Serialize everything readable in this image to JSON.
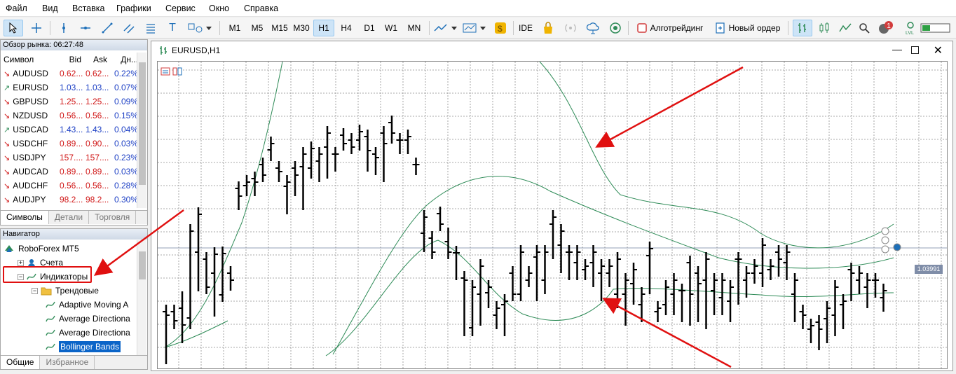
{
  "menu": [
    "Файл",
    "Вид",
    "Вставка",
    "Графики",
    "Сервис",
    "Окно",
    "Справка"
  ],
  "toolbar": {
    "timeframes": [
      "M1",
      "M5",
      "M15",
      "M30",
      "H1",
      "H4",
      "D1",
      "W1",
      "MN"
    ],
    "active_timeframe": "H1",
    "ide_label": "IDE",
    "algo_label": "Алготрейдинг",
    "new_order_label": "Новый ордер",
    "notification_count": "1",
    "icons": [
      "cursor-icon",
      "crosshair-icon",
      "vertical-line-icon",
      "horizontal-line-icon",
      "trendline-icon",
      "channel-icon",
      "fibonacci-icon",
      "text-icon",
      "shapes-icon",
      "chart-type-icon",
      "template-icon",
      "market-icon",
      "signals-icon",
      "vps-icon",
      "hosting-icon",
      "algo-stop-icon",
      "new-order-icon",
      "depth-icon",
      "bars-icon",
      "line-chart-icon",
      "search-icon",
      "user-icon",
      "signal-strength-icon"
    ]
  },
  "market_watch": {
    "title": "Обзор рынка: 06:27:48",
    "headers": [
      "Символ",
      "Bid",
      "Ask",
      "Дн..."
    ],
    "rows": [
      {
        "symbol": "AUDUSD",
        "bid": "0.62...",
        "ask": "0.62...",
        "change": "0.22%",
        "dir": "down"
      },
      {
        "symbol": "EURUSD",
        "bid": "1.03...",
        "ask": "1.03...",
        "change": "0.07%",
        "dir": "up"
      },
      {
        "symbol": "GBPUSD",
        "bid": "1.25...",
        "ask": "1.25...",
        "change": "0.09%",
        "dir": "down"
      },
      {
        "symbol": "NZDUSD",
        "bid": "0.56...",
        "ask": "0.56...",
        "change": "0.15%",
        "dir": "down"
      },
      {
        "symbol": "USDCAD",
        "bid": "1.43...",
        "ask": "1.43...",
        "change": "0.04%",
        "dir": "up"
      },
      {
        "symbol": "USDCHF",
        "bid": "0.89...",
        "ask": "0.90...",
        "change": "0.03%",
        "dir": "down"
      },
      {
        "symbol": "USDJPY",
        "bid": "157....",
        "ask": "157....",
        "change": "0.23%",
        "dir": "down"
      },
      {
        "symbol": "AUDCAD",
        "bid": "0.89...",
        "ask": "0.89...",
        "change": "0.03%",
        "dir": "down"
      },
      {
        "symbol": "AUDCHF",
        "bid": "0.56...",
        "ask": "0.56...",
        "change": "0.28%",
        "dir": "down"
      },
      {
        "symbol": "AUDJPY",
        "bid": "98.2...",
        "ask": "98.2...",
        "change": "0.30%",
        "dir": "down"
      }
    ],
    "tabs": [
      "Символы",
      "Детали",
      "Торговля"
    ]
  },
  "navigator": {
    "title": "Навигатор",
    "items": [
      {
        "label": "RoboForex MT5",
        "indent": 0
      },
      {
        "label": "Счета",
        "indent": 1
      },
      {
        "label": "Индикаторы",
        "indent": 1
      },
      {
        "label": "Трендовые",
        "indent": 2
      },
      {
        "label": "Adaptive Moving A",
        "indent": 3
      },
      {
        "label": "Average Directiona",
        "indent": 3
      },
      {
        "label": "Average Directiona",
        "indent": 3
      },
      {
        "label": "Bollinger Bands",
        "indent": 3
      }
    ],
    "tabs": [
      "Общие",
      "Избранное"
    ]
  },
  "chart": {
    "title": "EURUSD,H1",
    "price_label": "1.03991",
    "colors": {
      "bars": "#000000",
      "bands": "#2e8b57",
      "grid": "#8f8f8f",
      "arrow": "#e01010",
      "price_line": "#6f7f9f"
    }
  },
  "chart_data": {
    "type": "ohlc",
    "symbol": "EURUSD",
    "timeframe": "H1",
    "price_scale_label": "1.03991",
    "bars_hlco": [
      [
        385,
        388,
        450,
        390
      ],
      [
        385,
        392,
        400,
        398
      ],
      [
        380,
        366,
        420,
        404
      ],
      [
        394,
        400,
        315,
        270
      ],
      [
        300,
        308,
        346,
        246
      ],
      [
        310,
        310,
        320,
        350
      ],
      [
        330,
        334,
        382,
        303
      ],
      [
        361,
        361,
        350,
        302
      ],
      [
        330,
        330,
        345,
        340
      ],
      [
        209,
        209,
        230,
        220
      ],
      [
        205,
        210,
        200,
        200
      ],
      [
        195,
        200,
        210,
        200
      ],
      [
        175,
        180,
        190,
        190
      ],
      [
        154,
        160,
        145,
        145
      ],
      [
        180,
        185,
        190,
        185
      ],
      [
        206,
        206,
        236,
        200
      ],
      [
        180,
        190,
        210,
        190
      ],
      [
        178,
        178,
        230,
        160
      ],
      [
        180,
        185,
        170,
        152
      ],
      [
        170,
        180,
        190,
        160
      ],
      [
        150,
        155,
        185,
        130
      ],
      [
        160,
        162,
        175,
        160
      ],
      [
        133,
        133,
        140,
        145
      ],
      [
        140,
        140,
        150,
        150
      ],
      [
        140,
        145,
        135,
        128
      ],
      [
        135,
        138,
        175,
        155
      ],
      [
        160,
        170,
        180,
        165
      ],
      [
        130,
        133,
        190,
        145
      ],
      [
        115,
        115,
        135,
        130
      ],
      [
        140,
        145,
        150,
        140
      ],
      [
        140,
        145,
        150,
        135
      ],
      [
        175,
        175,
        180,
        175
      ],
      [
        273,
        280,
        290,
        250
      ],
      [
        280,
        282,
        300,
        300
      ],
      [
        245,
        245,
        260,
        260
      ],
      [
        285,
        275,
        300,
        300
      ],
      [
        301,
        305,
        330,
        301
      ],
      [
        337,
        337,
        410,
        340
      ],
      [
        408,
        410,
        370,
        350
      ],
      [
        360,
        356,
        395,
        320
      ],
      [
        358,
        370,
        370,
        350
      ],
      [
        390,
        390,
        400,
        380
      ],
      [
        375,
        376,
        410,
        370
      ],
      [
        330,
        330,
        350,
        360
      ],
      [
        360,
        360,
        360,
        300
      ],
      [
        340,
        340,
        335,
        330
      ],
      [
        307,
        307,
        360,
        300
      ],
      [
        340,
        340,
        350,
        300
      ],
      [
        260,
        260,
        300,
        250
      ],
      [
        290,
        300,
        320,
        270
      ],
      [
        300,
        305,
        330,
        300
      ],
      [
        315,
        315,
        330,
        300
      ],
      [
        325,
        325,
        330,
        320
      ],
      [
        315,
        325,
        340,
        300
      ],
      [
        330,
        330,
        360,
        320
      ],
      [
        330,
        335,
        340,
        320
      ],
      [
        360,
        360,
        370,
        310
      ],
      [
        360,
        360,
        395,
        340
      ],
      [
        345,
        345,
        365,
        325
      ],
      [
        375,
        375,
        390,
        360
      ],
      [
        305,
        306,
        350,
        295
      ],
      [
        385,
        385,
        390,
        380
      ],
      [
        375,
        375,
        380,
        350
      ],
      [
        360,
        360,
        380,
        340
      ],
      [
        355,
        355,
        390,
        355
      ],
      [
        315,
        315,
        395,
        360
      ],
      [
        330,
        330,
        390,
        345
      ],
      [
        340,
        340,
        400,
        310
      ],
      [
        355,
        360,
        380,
        340
      ],
      [
        365,
        365,
        380,
        340
      ],
      [
        370,
        370,
        390,
        350
      ],
      [
        310,
        310,
        365,
        310
      ],
      [
        340,
        340,
        355,
        330
      ],
      [
        330,
        330,
        335,
        320
      ],
      [
        330,
        330,
        340,
        290
      ],
      [
        325,
        325,
        330,
        320
      ],
      [
        300,
        300,
        325,
        310
      ],
      [
        315,
        315,
        330,
        300
      ],
      [
        360,
        360,
        390,
        340
      ],
      [
        385,
        385,
        400,
        390
      ],
      [
        410,
        410,
        420,
        405
      ],
      [
        400,
        400,
        430,
        410
      ],
      [
        395,
        395,
        420,
        380
      ],
      [
        390,
        390,
        410,
        350
      ],
      [
        375,
        375,
        400,
        370
      ],
      [
        325,
        325,
        360,
        330
      ],
      [
        340,
        340,
        350,
        330
      ],
      [
        350,
        350,
        370,
        340
      ],
      [
        340,
        340,
        355,
        340
      ],
      [
        365,
        365,
        375,
        355
      ]
    ]
  }
}
